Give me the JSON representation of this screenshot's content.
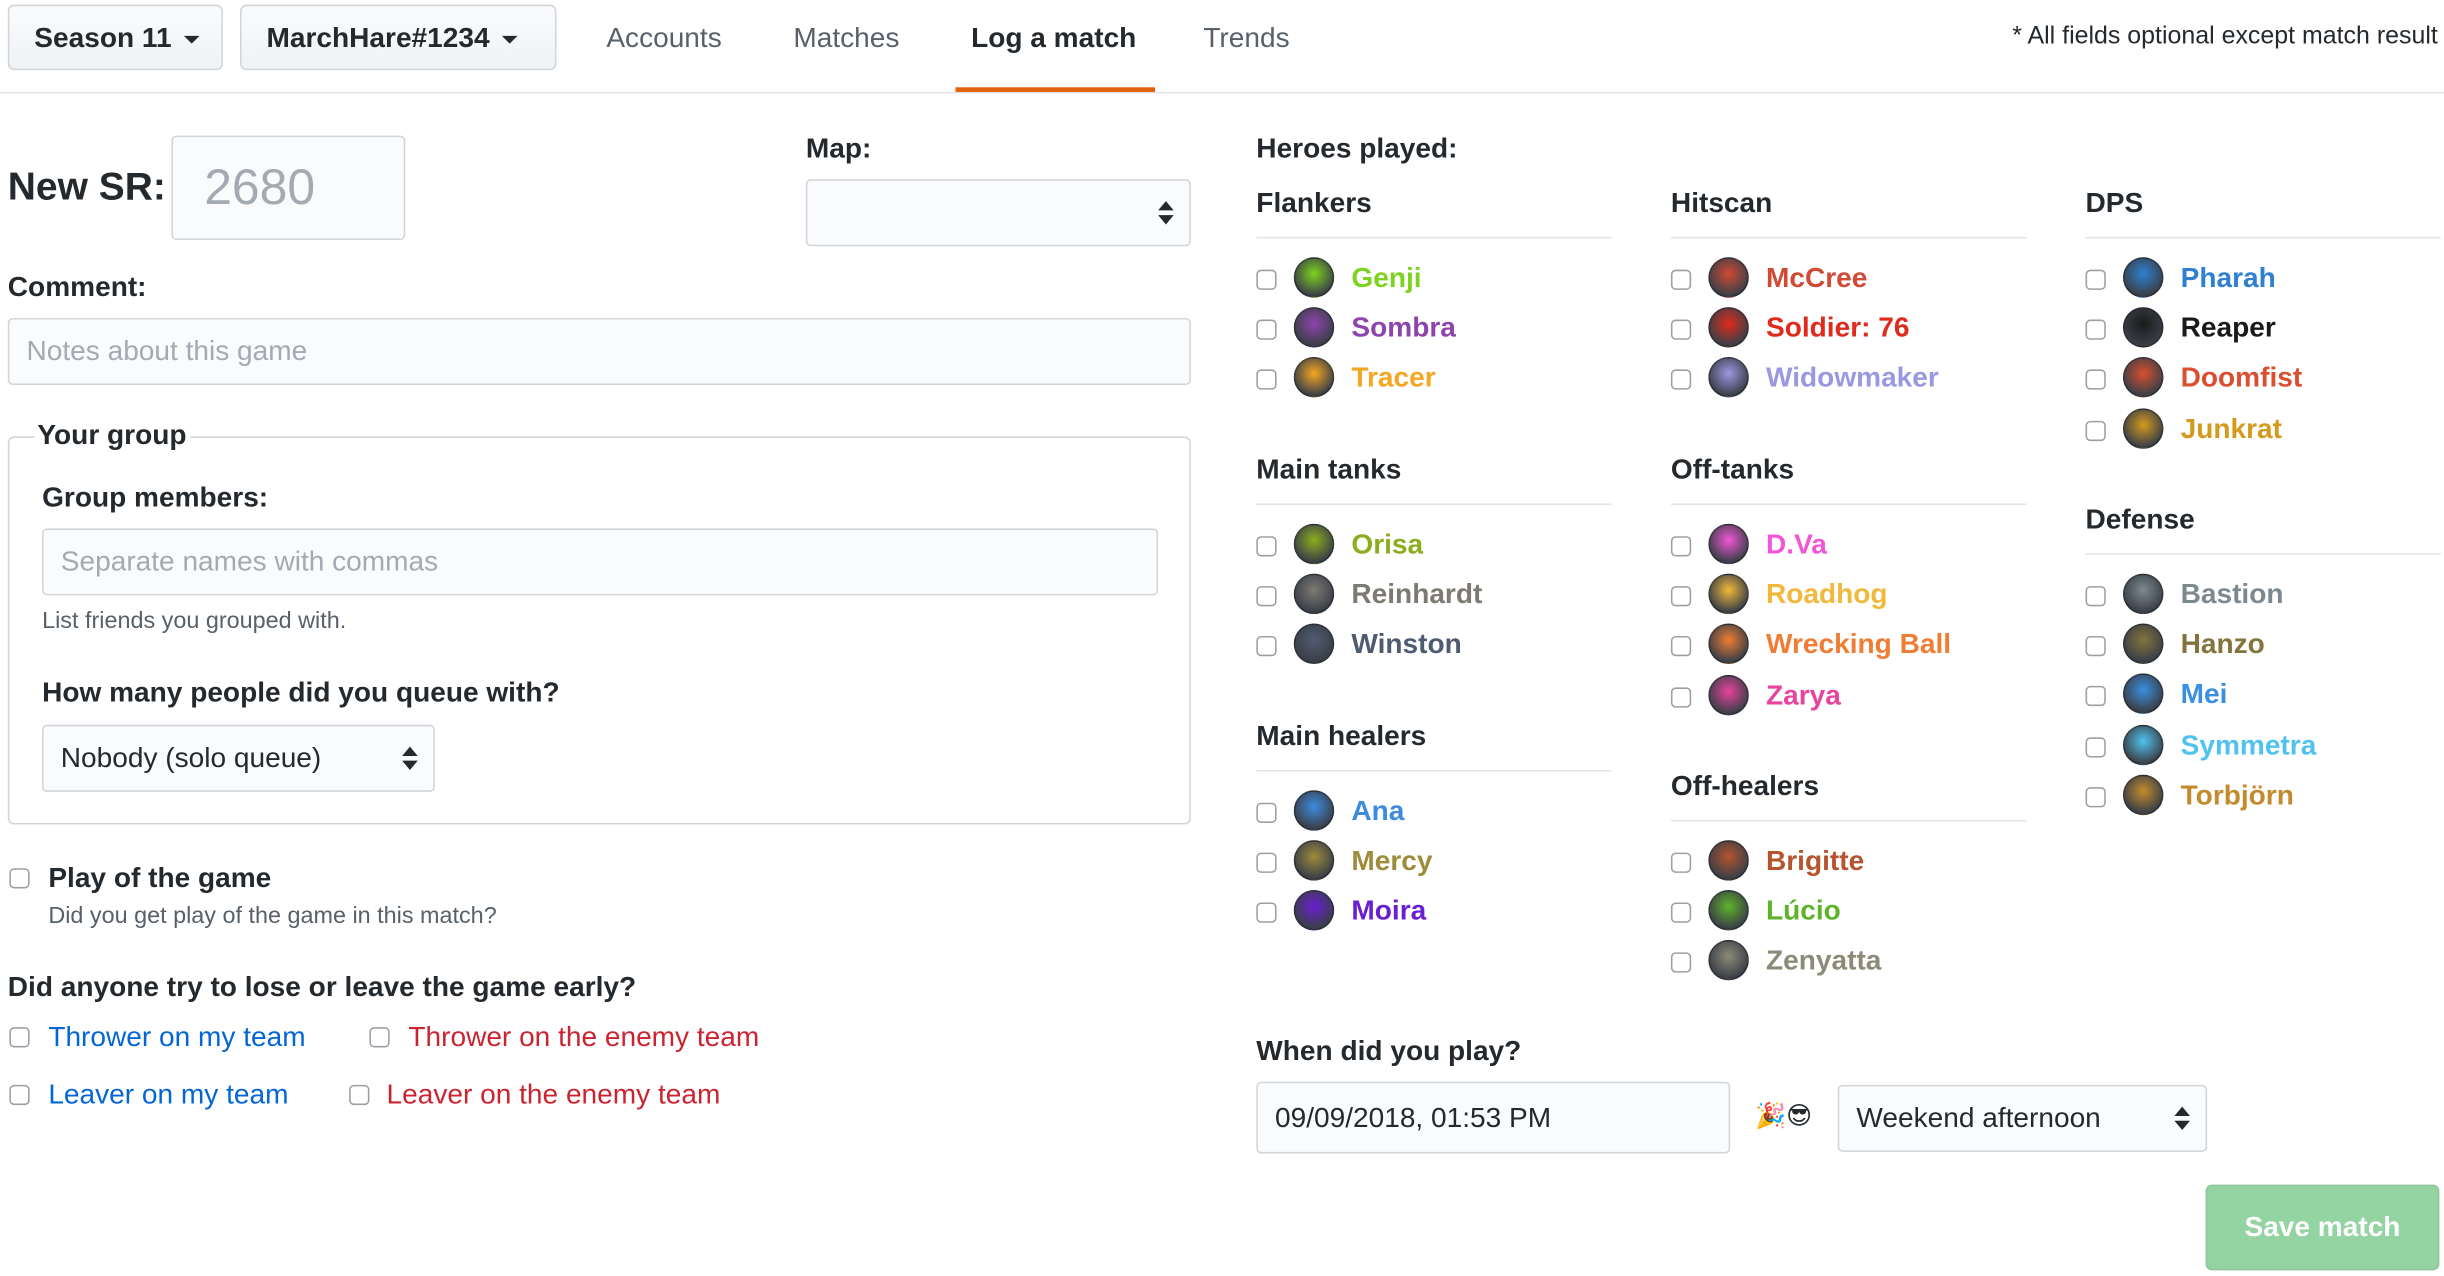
{
  "nav": {
    "season": "Season 11",
    "account": "MarchHare#1234",
    "tabs": [
      "Accounts",
      "Matches",
      "Log a match",
      "Trends"
    ],
    "active_tab": "Log a match",
    "note": "* All fields optional except match result",
    "accent_color": "#e36209"
  },
  "form": {
    "sr_label": "New SR:",
    "sr_placeholder": "2680",
    "map_label": "Map:",
    "map_value": "",
    "comment_label": "Comment:",
    "comment_placeholder": "Notes about this game",
    "group": {
      "legend": "Your group",
      "members_label": "Group members:",
      "members_placeholder": "Separate names with commas",
      "members_help": "List friends you grouped with.",
      "queue_label": "How many people did you queue with?",
      "queue_value": "Nobody (solo queue)"
    },
    "potg": {
      "label": "Play of the game",
      "help": "Did you get play of the game in this match?"
    },
    "throwers": {
      "question": "Did anyone try to lose or leave the game early?",
      "options": [
        "Thrower on my team",
        "Thrower on the enemy team",
        "Leaver on my team",
        "Leaver on the enemy team"
      ],
      "my_team_color": "#0366d6",
      "enemy_team_color": "#cb2431"
    }
  },
  "heroes": {
    "label": "Heroes played:",
    "groups": [
      {
        "title": "Flankers",
        "heroes": [
          {
            "name": "Genji",
            "color": "#7ed321"
          },
          {
            "name": "Sombra",
            "color": "#8e44ad"
          },
          {
            "name": "Tracer",
            "color": "#f5a623"
          }
        ]
      },
      {
        "title": "Main tanks",
        "heroes": [
          {
            "name": "Orisa",
            "color": "#8bad1e"
          },
          {
            "name": "Reinhardt",
            "color": "#7d7a74"
          },
          {
            "name": "Winston",
            "color": "#4f5b70"
          }
        ]
      },
      {
        "title": "Main healers",
        "heroes": [
          {
            "name": "Ana",
            "color": "#3d8be0"
          },
          {
            "name": "Mercy",
            "color": "#9e8b3b"
          },
          {
            "name": "Moira",
            "color": "#6a1fd1"
          }
        ]
      },
      {
        "title": "Hitscan",
        "heroes": [
          {
            "name": "McCree",
            "color": "#d14a35"
          },
          {
            "name": "Soldier: 76",
            "color": "#e02a1c"
          },
          {
            "name": "Widowmaker",
            "color": "#9b98e3"
          }
        ]
      },
      {
        "title": "Off-tanks",
        "heroes": [
          {
            "name": "D.Va",
            "color": "#f256d6"
          },
          {
            "name": "Roadhog",
            "color": "#f2b83b"
          },
          {
            "name": "Wrecking Ball",
            "color": "#f07d33"
          },
          {
            "name": "Zarya",
            "color": "#e8439d"
          }
        ]
      },
      {
        "title": "Off-healers",
        "heroes": [
          {
            "name": "Brigitte",
            "color": "#b5542f"
          },
          {
            "name": "Lúcio",
            "color": "#5fb32a"
          },
          {
            "name": "Zenyatta",
            "color": "#8c8b78"
          }
        ]
      },
      {
        "title": "DPS",
        "heroes": [
          {
            "name": "Pharah",
            "color": "#2f80d1"
          },
          {
            "name": "Reaper",
            "color": "#1a1a1a"
          },
          {
            "name": "Doomfist",
            "color": "#d94f30"
          },
          {
            "name": "Junkrat",
            "color": "#d49a1e"
          }
        ]
      },
      {
        "title": "Defense",
        "heroes": [
          {
            "name": "Bastion",
            "color": "#7c8a8f"
          },
          {
            "name": "Hanzo",
            "color": "#83733c"
          },
          {
            "name": "Mei",
            "color": "#3a8fe0"
          },
          {
            "name": "Symmetra",
            "color": "#4fc3ee"
          },
          {
            "name": "Torbjörn",
            "color": "#c38b2c"
          }
        ]
      }
    ]
  },
  "when": {
    "label": "When did you play?",
    "datetime": "09/09/2018, 01:53 PM",
    "emoji": "🎉😎",
    "period": "Weekend afternoon"
  },
  "save_label": "Save match"
}
